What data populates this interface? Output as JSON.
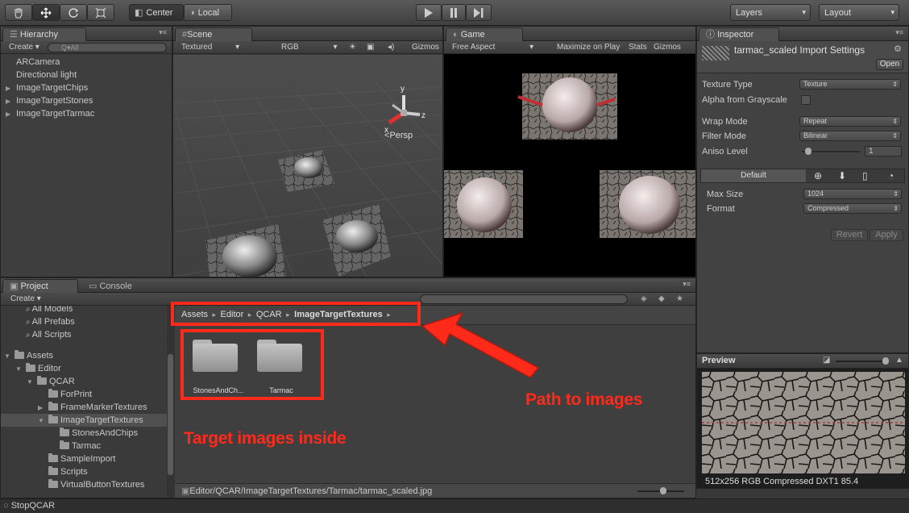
{
  "toolbar": {
    "tools": [
      "hand-tool",
      "move-tool",
      "rotate-tool",
      "scale-tool"
    ],
    "pivot_label": "Center",
    "space_label": "Local",
    "layers_label": "Layers",
    "layout_label": "Layout"
  },
  "hierarchy": {
    "tab": "Hierarchy",
    "create": "Create",
    "search_placeholder": "Q▾All",
    "items": [
      "ARCamera",
      "Directional light",
      "ImageTargetChips",
      "ImageTargetStones",
      "ImageTargetTarmac"
    ]
  },
  "scene": {
    "tab": "Scene",
    "shading": "Textured",
    "render_mode": "RGB",
    "gizmos": "Gizmos",
    "persp": "Persp",
    "axis_x": "x",
    "axis_y": "y",
    "axis_z": "z"
  },
  "game": {
    "tab": "Game",
    "aspect": "Free Aspect",
    "maximize": "Maximize on Play",
    "stats": "Stats",
    "gizmos": "Gizmos"
  },
  "inspector": {
    "tab": "Inspector",
    "title": "tarmac_scaled Import Settings",
    "open_button": "Open",
    "texture_type_label": "Texture Type",
    "texture_type_value": "Texture",
    "alpha_label": "Alpha from Grayscale",
    "wrap_label": "Wrap Mode",
    "wrap_value": "Repeat",
    "filter_label": "Filter Mode",
    "filter_value": "Bilinear",
    "aniso_label": "Aniso Level",
    "aniso_value": "1",
    "platform_default": "Default",
    "max_size_label": "Max Size",
    "max_size_value": "1024",
    "format_label": "Format",
    "format_value": "Compressed",
    "revert": "Revert",
    "apply": "Apply"
  },
  "preview": {
    "title": "Preview",
    "info": "512x256  RGB Compressed DXT1   85.4"
  },
  "project": {
    "tab": "Project",
    "console_tab": "Console",
    "create": "Create",
    "tree": [
      {
        "label": "All Models",
        "indent": 1,
        "type": "search"
      },
      {
        "label": "All Prefabs",
        "indent": 1,
        "type": "search"
      },
      {
        "label": "All Scripts",
        "indent": 1,
        "type": "search"
      },
      {
        "label": "Assets",
        "indent": 0,
        "type": "folder",
        "arrow": "▼"
      },
      {
        "label": "Editor",
        "indent": 1,
        "type": "folder",
        "arrow": "▼"
      },
      {
        "label": "QCAR",
        "indent": 2,
        "type": "folder",
        "arrow": "▼"
      },
      {
        "label": "ForPrint",
        "indent": 3,
        "type": "folder",
        "arrow": ""
      },
      {
        "label": "FrameMarkerTextures",
        "indent": 3,
        "type": "folder",
        "arrow": "▶"
      },
      {
        "label": "ImageTargetTextures",
        "indent": 3,
        "type": "folder",
        "arrow": "▼"
      },
      {
        "label": "StonesAndChips",
        "indent": 4,
        "type": "folder",
        "arrow": ""
      },
      {
        "label": "Tarmac",
        "indent": 4,
        "type": "folder",
        "arrow": ""
      },
      {
        "label": "SampleImport",
        "indent": 3,
        "type": "folder",
        "arrow": ""
      },
      {
        "label": "Scripts",
        "indent": 3,
        "type": "folder",
        "arrow": ""
      },
      {
        "label": "VirtualButtonTextures",
        "indent": 3,
        "type": "folder",
        "arrow": ""
      }
    ],
    "breadcrumb": [
      "Assets",
      "Editor",
      "QCAR",
      "ImageTargetTextures"
    ],
    "folders": [
      "StonesAndCh...",
      "Tarmac"
    ],
    "status_path": "Editor/QCAR/ImageTargetTextures/Tarmac/tarmac_scaled.jpg"
  },
  "annotations": {
    "path_callout": "Path to images",
    "target_callout": "Target images inside"
  },
  "status_bar": {
    "text": "StopQCAR"
  },
  "colors": {
    "callout_red": "#ff2a1a"
  }
}
